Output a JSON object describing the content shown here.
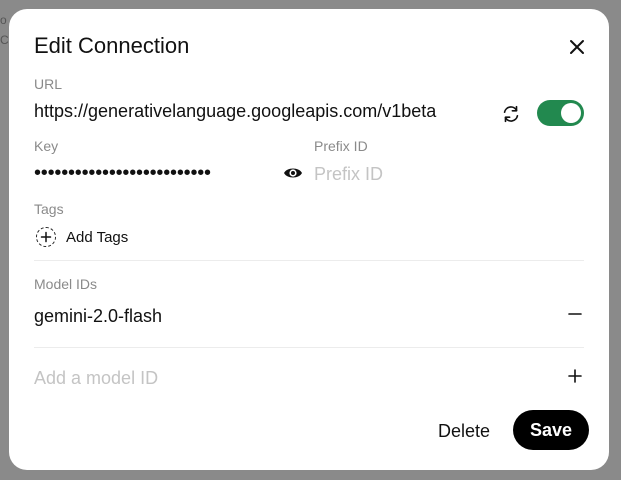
{
  "background": {
    "fragment_1": "o",
    "fragment_2": "C"
  },
  "modal": {
    "title": "Edit Connection",
    "close_icon": "close-icon",
    "url": {
      "label": "URL",
      "value": "https://generativelanguage.googleapis.com/v1beta",
      "refresh_icon": "refresh-icon",
      "enabled": true,
      "toggle_color": "#22894f"
    },
    "key": {
      "label": "Key",
      "masked_value": "••••••••••••••••••••••••••",
      "visibility_icon": "eye-icon"
    },
    "prefix": {
      "label": "Prefix ID",
      "placeholder": "Prefix ID",
      "value": ""
    },
    "tags": {
      "label": "Tags",
      "add_label": "Add Tags",
      "add_icon": "plus-circle-icon"
    },
    "models": {
      "label": "Model IDs",
      "items": [
        "gemini-2.0-flash"
      ],
      "remove_icon": "minus-icon",
      "add_placeholder": "Add a model ID",
      "add_icon": "plus-icon"
    },
    "actions": {
      "delete_label": "Delete",
      "save_label": "Save"
    }
  }
}
